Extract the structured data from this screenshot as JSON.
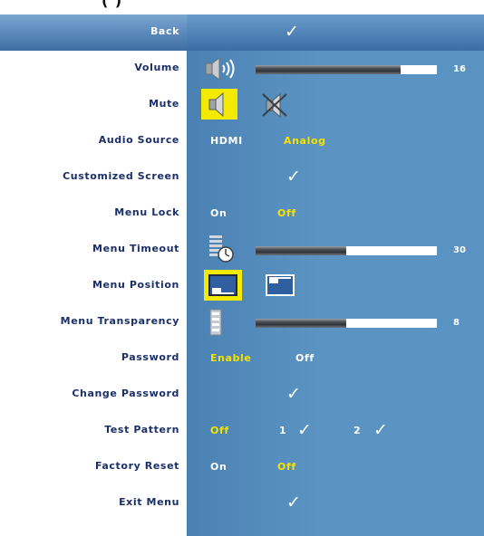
{
  "title_fragment": "(          )",
  "menu": {
    "back": {
      "label": "Back",
      "value": "✓"
    },
    "volume": {
      "label": "Volume",
      "value": 16,
      "max": 20,
      "icon": "speaker-volume-icon"
    },
    "mute": {
      "label": "Mute",
      "icons": [
        "speaker-icon",
        "speaker-muted-icon"
      ],
      "selected": "speaker-icon"
    },
    "audio_source": {
      "label": "Audio Source",
      "options": [
        "HDMI",
        "Analog"
      ],
      "selected": "Analog"
    },
    "customized_screen": {
      "label": "Customized Screen",
      "value": "✓"
    },
    "menu_lock": {
      "label": "Menu Lock",
      "options": [
        "On",
        "Off"
      ],
      "selected": "Off"
    },
    "menu_timeout": {
      "label": "Menu Timeout",
      "value": 30,
      "max": 60,
      "icon": "timer-icon"
    },
    "menu_position": {
      "label": "Menu Position",
      "icons": [
        "position-bottom-left-icon",
        "position-top-left-icon"
      ],
      "selected": "position-bottom-left-icon"
    },
    "menu_transparency": {
      "label": "Menu Transparency",
      "value": 8,
      "max": 16,
      "icon": "transparency-level-icon"
    },
    "password": {
      "label": "Password",
      "options": [
        "Enable",
        "Off"
      ],
      "selected": "Enable"
    },
    "change_password": {
      "label": "Change Password",
      "value": "✓"
    },
    "test_pattern": {
      "label": "Test Pattern",
      "options": [
        "Off",
        "1",
        "2"
      ],
      "checks": [
        "✓",
        "✓"
      ],
      "selected": "Off"
    },
    "factory_reset": {
      "label": "Factory Reset",
      "options": [
        "On",
        "Off"
      ],
      "selected": "Off"
    },
    "exit_menu": {
      "label": "Exit Menu",
      "value": "✓"
    }
  },
  "colors": {
    "label_text": "#1b2f68",
    "value_panel": "#5a93c2",
    "active_option": "#f4e300",
    "selected_row": "#3f6ea3"
  }
}
